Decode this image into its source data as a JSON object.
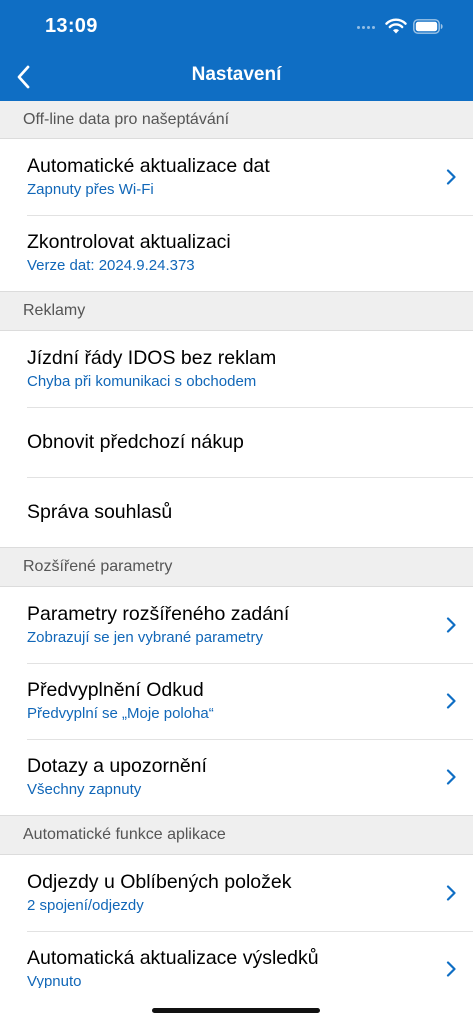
{
  "status_bar": {
    "time": "13:09"
  },
  "nav": {
    "title": "Nastavení"
  },
  "sections": [
    {
      "header": "Off-line data pro našeptávání",
      "rows": [
        {
          "title": "Automatické aktualizace dat",
          "subtitle": "Zapnuty přes Wi-Fi",
          "chevron": true
        },
        {
          "title": "Zkontrolovat aktualizaci",
          "subtitle": "Verze dat: 2024.9.24.373",
          "chevron": false
        }
      ]
    },
    {
      "header": "Reklamy",
      "rows": [
        {
          "title": "Jízdní řády IDOS bez reklam",
          "subtitle": "Chyba při komunikaci s obchodem",
          "chevron": false
        },
        {
          "title": "Obnovit předchozí nákup",
          "chevron": false
        },
        {
          "title": "Správa souhlasů",
          "chevron": false
        }
      ]
    },
    {
      "header": "Rozšířené parametry",
      "rows": [
        {
          "title": "Parametry rozšířeného zadání",
          "subtitle": "Zobrazují se jen vybrané parametry",
          "chevron": true
        },
        {
          "title": "Předvyplnění Odkud",
          "subtitle": "Předvyplní se „Moje poloha“",
          "chevron": true
        },
        {
          "title": "Dotazy a upozornění",
          "subtitle": "Všechny zapnuty",
          "chevron": true
        }
      ]
    },
    {
      "header": "Automatické funkce aplikace",
      "rows": [
        {
          "title": "Odjezdy u Oblíbených položek",
          "subtitle": "2 spojení/odjezdy",
          "chevron": true
        },
        {
          "title": "Automatická aktualizace výsledků",
          "subtitle": "Vypnuto",
          "chevron": true
        }
      ]
    }
  ],
  "colors": {
    "header_bg": "#0f6ec4",
    "subtitle": "#1167b8",
    "section_bg": "#efefef"
  },
  "icons": {
    "back": "chevron-left-icon",
    "row": "chevron-right-icon",
    "wifi": "wifi-icon",
    "battery": "battery-icon",
    "signal": "cellular-signal-icon"
  }
}
